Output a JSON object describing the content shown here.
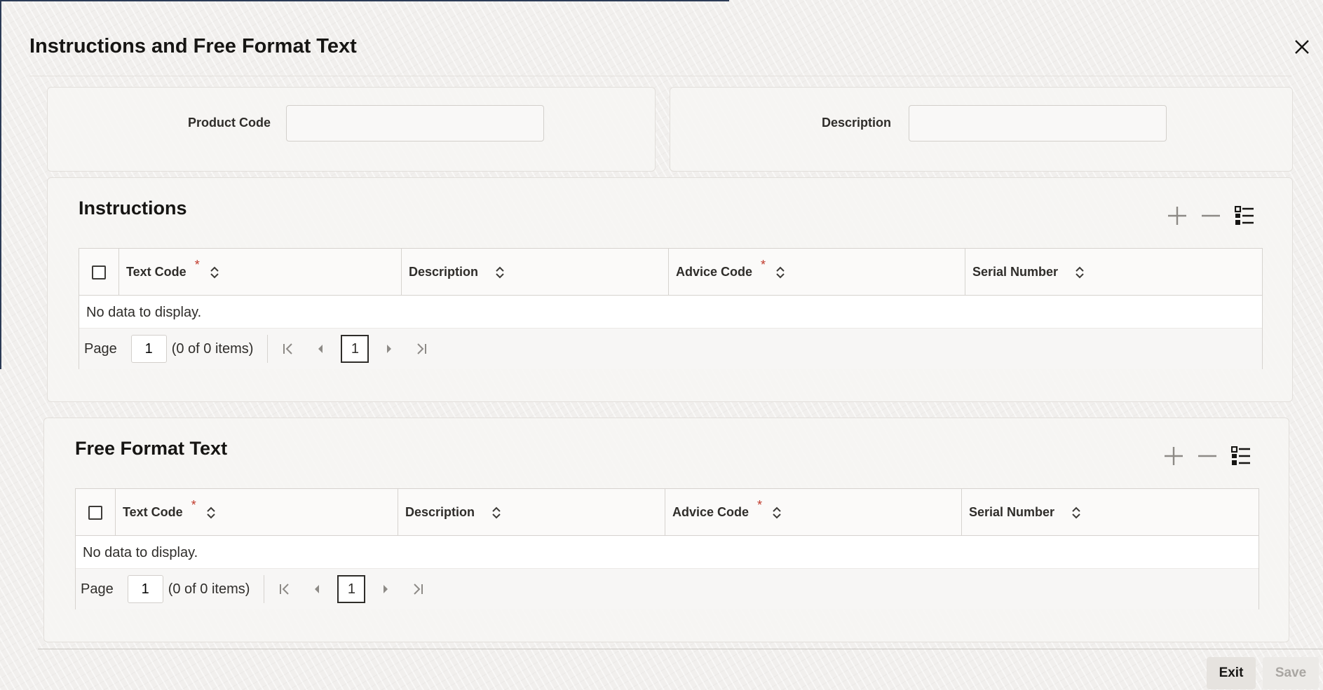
{
  "dialog": {
    "title": "Instructions and Free Format Text",
    "close_icon": "close-icon"
  },
  "header_form": {
    "product_code_label": "Product Code",
    "product_code_value": "",
    "description_label": "Description",
    "description_value": ""
  },
  "instructions": {
    "title": "Instructions",
    "toolbar_icons": [
      "plus-icon",
      "minus-icon",
      "column-list-icon"
    ],
    "columns": {
      "text_code": "Text Code",
      "description": "Description",
      "advice_code": "Advice Code",
      "serial_number": "Serial Number"
    },
    "required_marker": "*",
    "empty_message": "No data to display.",
    "pager": {
      "page_label": "Page",
      "page_value": "1",
      "items_text": "(0 of 0 items)",
      "current_page": "1"
    }
  },
  "free_format_text": {
    "title": "Free Format Text",
    "toolbar_icons": [
      "plus-icon",
      "minus-icon",
      "column-list-icon"
    ],
    "columns": {
      "text_code": "Text Code",
      "description": "Description",
      "advice_code": "Advice Code",
      "serial_number": "Serial Number"
    },
    "required_marker": "*",
    "empty_message": "No data to display.",
    "pager": {
      "page_label": "Page",
      "page_value": "1",
      "items_text": "(0 of 0 items)",
      "current_page": "1"
    }
  },
  "footer": {
    "exit_label": "Exit",
    "save_label": "Save"
  },
  "colors": {
    "required": "#c0392b",
    "disabled_text": "#a9a6a2"
  }
}
